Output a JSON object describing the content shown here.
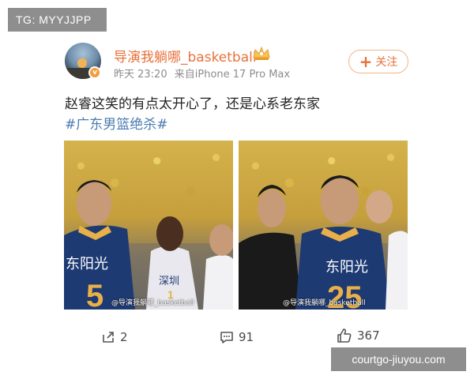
{
  "overlay": {
    "tg": "TG: MYYJJPP",
    "site": "courtgo-jiuyou.com"
  },
  "post": {
    "username": "导演我躺哪_basketball",
    "time": "昨天 23:20",
    "source": "来自iPhone 17 Pro Max",
    "follow_label": "关注",
    "text": "赵睿这笑的有点太开心了，还是心系老东家",
    "hashtag": "#广东男篮绝杀#",
    "watermark_1": "@导演我躺哪_basketball",
    "watermark_2": "@导演我躺哪_basketball"
  },
  "players": {
    "jersey_text_1": "东阳光",
    "number_1": "5",
    "jersey_text_2": "东阳光",
    "number_2": "25",
    "opponent_jersey": "深圳",
    "opponent_number": "1"
  },
  "actions": {
    "share": "2",
    "comment": "91",
    "like": "367"
  },
  "colors": {
    "username": "#e8713a",
    "hashtag": "#4a7bb0",
    "jersey": "#1d3a72",
    "jersey_text": "#e9b04a"
  },
  "icons": {
    "crown": "crown-icon",
    "verified": "verified-badge-icon",
    "plus": "plus-icon",
    "share": "share-icon",
    "comment": "comment-icon",
    "like": "thumbs-up-icon"
  }
}
